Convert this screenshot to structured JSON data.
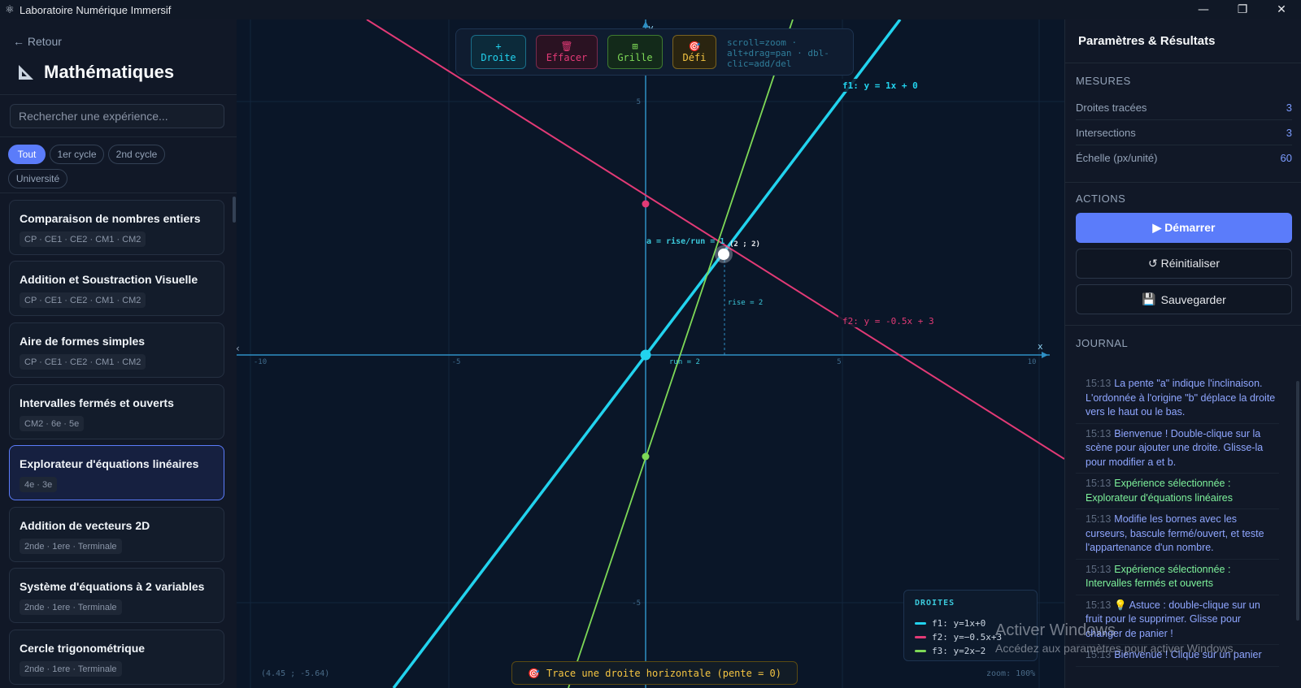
{
  "window": {
    "title": "Laboratoire Numérique Immersif"
  },
  "sidebar": {
    "back": "← Retour",
    "title": "Mathématiques",
    "search_placeholder": "Rechercher une expérience...",
    "filters": [
      "Tout",
      "1er cycle",
      "2nd cycle",
      "Université"
    ],
    "experiments": [
      {
        "title": "Comparaison de nombres entiers",
        "levels": "CP · CE1 · CE2 · CM1 · CM2"
      },
      {
        "title": "Addition et Soustraction Visuelle",
        "levels": "CP · CE1 · CE2 · CM1 · CM2"
      },
      {
        "title": "Aire de formes simples",
        "levels": "CP · CE1 · CE2 · CM1 · CM2"
      },
      {
        "title": "Intervalles fermés et ouverts",
        "levels": "CM2 · 6e · 5e"
      },
      {
        "title": "Explorateur d'équations linéaires",
        "levels": "4e · 3e"
      },
      {
        "title": "Addition de vecteurs 2D",
        "levels": "2nde · 1ere · Terminale"
      },
      {
        "title": "Système d'équations à 2 variables",
        "levels": "2nde · 1ere · Terminale"
      },
      {
        "title": "Cercle trigonométrique",
        "levels": "2nde · 1ere · Terminale"
      }
    ]
  },
  "toolbar": {
    "add_line": {
      "icon": "+",
      "label": "Droite"
    },
    "erase": {
      "icon": "🗑",
      "label": "Effacer"
    },
    "grid": {
      "icon": "⊞",
      "label": "Grille"
    },
    "challenge": {
      "icon": "🎯",
      "label": "Défi"
    },
    "hint": "scroll=zoom · alt+drag=pan · dbl-clic=add/del"
  },
  "plot": {
    "ticks_x": [
      "-10",
      "-5",
      "5",
      "10"
    ],
    "ticks_y": [
      "5",
      "-5"
    ],
    "axis_x": "x",
    "axis_y": "y",
    "line_labels": [
      "f1: y = 1x + 0",
      "f2: y = -0.5x + 3"
    ],
    "slope_label": "a = rise/run = 1",
    "point_label": "(2 ; 2)",
    "rise_label": "rise = 2",
    "run_label": "run = 2",
    "colors": {
      "f1": "#22d3ee",
      "f2": "#e23a76",
      "f3": "#7ed957"
    }
  },
  "legend": {
    "title": "DROITES",
    "items": [
      "f1: y=1x+0",
      "f2: y=−0.5x+3",
      "f3: y=2x−2"
    ]
  },
  "status": {
    "coords": "(4.45 ; -5.64)",
    "zoom": "zoom: 100%",
    "challenge_icon": "🎯",
    "challenge": "Trace une droite horizontale (pente = 0)"
  },
  "right_panel": {
    "title": "Paramètres & Résultats",
    "measures_title": "MESURES",
    "measures": [
      {
        "label": "Droites tracées",
        "value": "3"
      },
      {
        "label": "Intersections",
        "value": "3"
      },
      {
        "label": "Échelle (px/unité)",
        "value": "60"
      }
    ],
    "actions_title": "ACTIONS",
    "start": "▶ Démarrer",
    "reset": "↺ Réinitialiser",
    "save_icon": "💾",
    "save": "Sauvegarder",
    "journal_title": "JOURNAL",
    "journal": [
      {
        "time": "15:13",
        "text": "La pente \"a\" indique l'inclinaison. L'ordonnée à l'origine \"b\" déplace la droite vers le haut ou le bas."
      },
      {
        "time": "15:13",
        "text": "Bienvenue ! Double-clique sur la scène pour ajouter une droite. Glisse-la pour modifier a et b."
      },
      {
        "time": "15:13",
        "text": "Expérience sélectionnée : Explorateur d'équations linéaires"
      },
      {
        "time": "15:13",
        "text": "Modifie les bornes avec les curseurs, bascule fermé/ouvert, et teste l'appartenance d'un nombre."
      },
      {
        "time": "15:13",
        "text": "Expérience sélectionnée : Intervalles fermés et ouverts"
      },
      {
        "time": "15:13",
        "text": "💡 Astuce : double-clique sur un fruit pour le supprimer. Glisse pour changer de panier !"
      },
      {
        "time": "15:13",
        "text": "Bienvenue ! Clique sur un panier"
      }
    ]
  },
  "watermark": {
    "line1": "Activer Windows",
    "line2": "Accédez aux paramètres pour activer Windows."
  }
}
